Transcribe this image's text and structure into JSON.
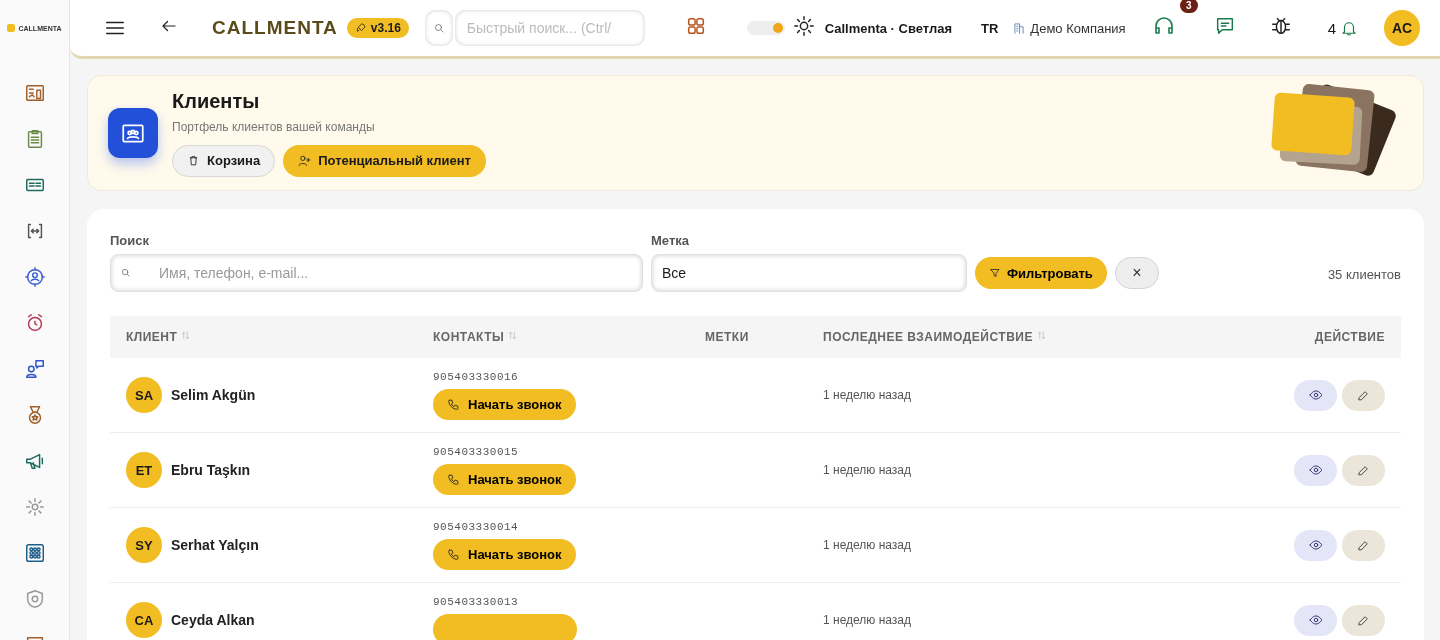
{
  "brand": {
    "logo_text": "CALLMENTA",
    "title": "CALLMENTA",
    "version": "v3.16"
  },
  "topbar": {
    "search_placeholder": "Быстрый поиск... (Ctrl/",
    "theme_light": true,
    "theme_label": "Callmenta · ",
    "theme_name": "Светлая",
    "language": "TR",
    "company": "Демо Компания",
    "support_badge": "3",
    "notification_count": "4",
    "avatar": "AC"
  },
  "header": {
    "title": "Клиенты",
    "subtitle": "Портфель клиентов вашей команды",
    "buttons": [
      {
        "kind": "trash",
        "label": "Корзина"
      },
      {
        "kind": "add",
        "label": "Потенциальный клиент"
      }
    ]
  },
  "filters": {
    "search_label": "Поиск",
    "search_placeholder": "Имя, телефон, e-mail...",
    "tag_label": "Метка",
    "tag_value": "Все",
    "filter_button": "Фильтровать",
    "clear_button": "×",
    "count": "35 клиентов"
  },
  "table": {
    "columns": [
      {
        "label": "КЛИЕНТ",
        "sortable": true
      },
      {
        "label": "КОНТАКТЫ",
        "sortable": true
      },
      {
        "label": "МЕТКИ",
        "sortable": false
      },
      {
        "label": "ПОСЛЕДНЕЕ ВЗАИМОДЕЙСТВИЕ",
        "sortable": true
      },
      {
        "label": "ДЕЙСТВИЕ",
        "sortable": false
      }
    ],
    "rows": [
      {
        "initials": "SA",
        "name": "Selim Akgün",
        "phone": "905403330016",
        "call": "Начать звонок",
        "last": "1 неделю назад"
      },
      {
        "initials": "ET",
        "name": "Ebru Taşkın",
        "phone": "905403330015",
        "call": "Начать звонок",
        "last": "1 неделю назад"
      },
      {
        "initials": "SY",
        "name": "Serhat Yalçın",
        "phone": "905403330014",
        "call": "Начать звонок",
        "last": "1 неделю назад"
      },
      {
        "initials": "CA",
        "name": "Ceyda Alkan",
        "phone": "905403330013",
        "last": "1 неделю назад"
      }
    ]
  }
}
